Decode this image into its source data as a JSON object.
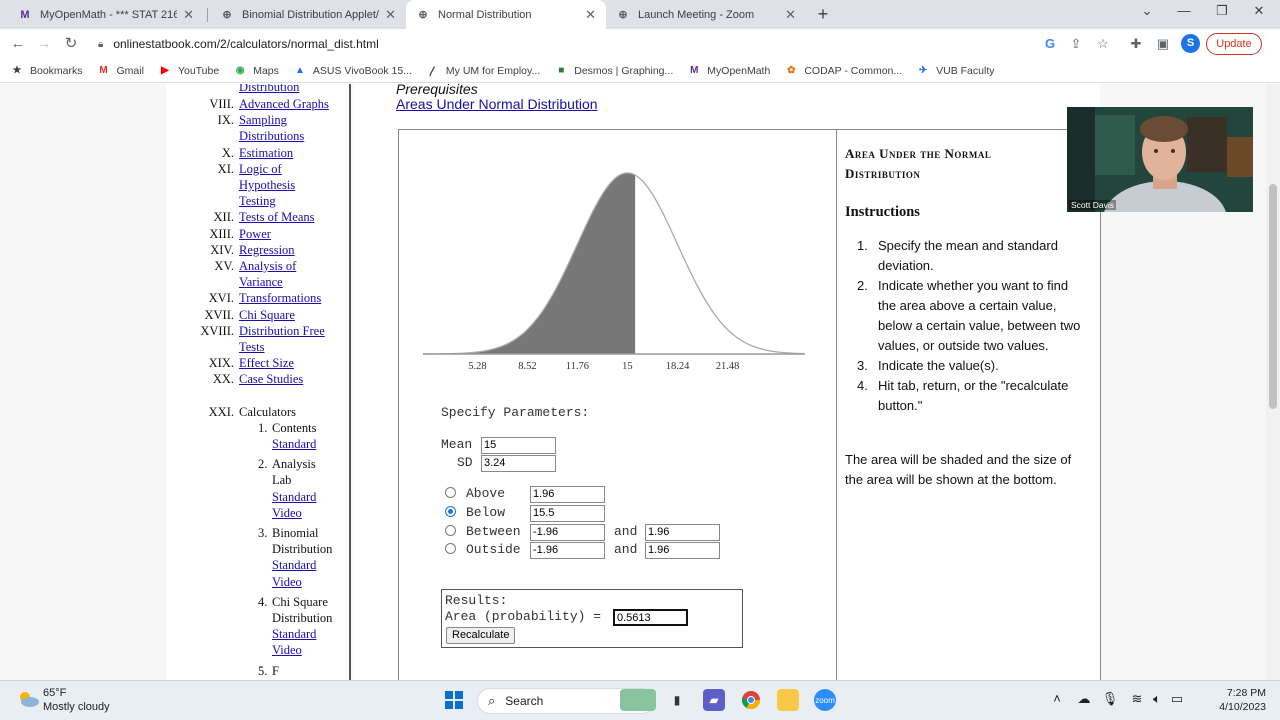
{
  "tabs": [
    {
      "title": "MyOpenMath - *** STAT 216 ON...",
      "icon": "myopenmath-icon",
      "glyph": "M"
    },
    {
      "title": "Binomial Distribution Applet/Cal",
      "icon": "globe-icon",
      "glyph": "⊕"
    },
    {
      "title": "Normal Distribution",
      "icon": "globe-icon",
      "glyph": "⊕"
    },
    {
      "title": "Launch Meeting - Zoom",
      "icon": "globe-icon",
      "glyph": "⊕"
    }
  ],
  "url": "onlinestatbook.com/2/calculators/normal_dist.html",
  "update_label": "Update",
  "profile_initial": "S",
  "bookmarks": [
    {
      "label": "Bookmarks",
      "icon": "star-icon",
      "glyph": "★",
      "color": "#3c4043"
    },
    {
      "label": "Gmail",
      "icon": "gmail-icon",
      "glyph": "M",
      "color": "#d93025"
    },
    {
      "label": "YouTube",
      "icon": "youtube-icon",
      "glyph": "▶",
      "color": "#ff0000"
    },
    {
      "label": "Maps",
      "icon": "maps-icon",
      "glyph": "◉",
      "color": "#34a853"
    },
    {
      "label": "ASUS VivoBook 15...",
      "icon": "asus-icon",
      "glyph": "▲",
      "color": "#1a73e8"
    },
    {
      "label": "My UM for Employ...",
      "icon": "um-icon",
      "glyph": "〳",
      "color": "#3c4043"
    },
    {
      "label": "Desmos | Graphing...",
      "icon": "desmos-icon",
      "glyph": "■",
      "color": "#2e7d32"
    },
    {
      "label": "MyOpenMath",
      "icon": "myopenmath-icon",
      "glyph": "M",
      "color": "#5c2d91"
    },
    {
      "label": "CODAP - Common...",
      "icon": "codap-icon",
      "glyph": "✿",
      "color": "#e8710a"
    },
    {
      "label": "VUB Faculty",
      "icon": "vub-icon",
      "glyph": "✈",
      "color": "#1a73e8"
    }
  ],
  "sidebar": {
    "top_fragment": "Distribution",
    "items": [
      {
        "num": "VIII.",
        "lines": [
          "Advanced Graphs"
        ]
      },
      {
        "num": "IX.",
        "lines": [
          "Sampling",
          "Distributions"
        ]
      },
      {
        "num": "X.",
        "lines": [
          "Estimation"
        ]
      },
      {
        "num": "XI.",
        "lines": [
          "Logic of",
          "Hypothesis",
          "Testing"
        ]
      },
      {
        "num": "XII.",
        "lines": [
          "Tests of Means"
        ]
      },
      {
        "num": "XIII.",
        "lines": [
          "Power"
        ]
      },
      {
        "num": "XIV.",
        "lines": [
          "Regression"
        ]
      },
      {
        "num": "XV.",
        "lines": [
          "Analysis of",
          "Variance"
        ]
      },
      {
        "num": "XVI.",
        "lines": [
          "Transformations"
        ]
      },
      {
        "num": "XVII.",
        "lines": [
          "Chi Square"
        ]
      },
      {
        "num": "XVIII.",
        "lines": [
          "Distribution Free",
          "Tests"
        ]
      },
      {
        "num": "XIX.",
        "lines": [
          "Effect Size"
        ]
      },
      {
        "num": "XX.",
        "lines": [
          "Case Studies"
        ]
      }
    ],
    "calculators": {
      "num": "XXI.",
      "label": "Calculators",
      "subs": [
        {
          "num": "1.",
          "text": [
            "Contents"
          ],
          "links": [
            "Standard"
          ]
        },
        {
          "num": "2.",
          "text": [
            "Analysis",
            "Lab"
          ],
          "links": [
            "Standard",
            "Video"
          ]
        },
        {
          "num": "3.",
          "text": [
            "Binomial",
            "Distribution"
          ],
          "links": [
            "Standard",
            "Video"
          ]
        },
        {
          "num": "4.",
          "text": [
            "Chi Square",
            "Distribution"
          ],
          "links": [
            "Standard",
            "Video"
          ]
        },
        {
          "num": "5.",
          "text": [
            "F"
          ],
          "links": []
        }
      ]
    }
  },
  "main": {
    "prereq_label": "Prerequisites",
    "prereq_link": "Areas Under Normal Distribution"
  },
  "chart_data": {
    "type": "area",
    "mean": 15,
    "sd": 3.24,
    "shaded": "below",
    "cutoff": 15.5,
    "x_ticks": [
      "5.28",
      "8.52",
      "11.76",
      "15",
      "18.24",
      "21.48"
    ],
    "xlim": [
      1.76,
      26.5
    ],
    "shade_color": "#777777",
    "curve_color": "#aaaaaa"
  },
  "params": {
    "title": "Specify Parameters:",
    "mean_label": "Mean",
    "mean_value": "15",
    "sd_label": "SD",
    "sd_value": "3.24",
    "options": [
      {
        "label": "Above",
        "v1": "1.96",
        "selected": false
      },
      {
        "label": "Below",
        "v1": "15.5",
        "selected": true
      },
      {
        "label": "Between",
        "v1": "-1.96",
        "and": "and",
        "v2": "1.96",
        "selected": false
      },
      {
        "label": "Outside",
        "v1": "-1.96",
        "and": "and",
        "v2": "1.96",
        "selected": false
      }
    ],
    "results_label": "Results:",
    "area_label": "Area (probability) =",
    "area_value": "0.5613",
    "recalc_label": "Recalculate"
  },
  "instructions": {
    "title": "Area Under the Normal Distribution",
    "heading": "Instructions",
    "steps": [
      "Specify the mean and standard deviation.",
      "Indicate whether you want to find the area above a certain value, below a certain value, between two values, or outside two values.",
      "Indicate the value(s).",
      "Hit tab, return, or the \"recalculate button.\""
    ],
    "note": "The area will be shaded and the size of the area will be shown at the bottom."
  },
  "webcam_name": "Scott Davis",
  "taskbar": {
    "temp": "65°F",
    "weather": "Mostly cloudy",
    "search": "Search",
    "time": "7:28 PM",
    "date": "4/10/2023"
  }
}
